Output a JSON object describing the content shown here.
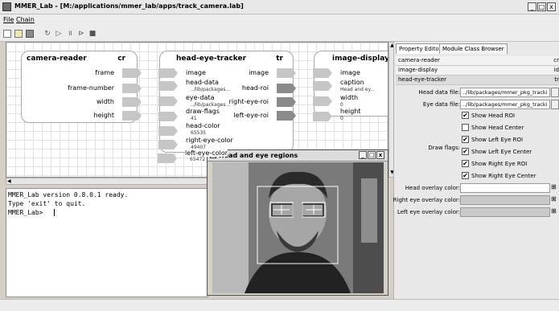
{
  "window": {
    "title": "MMER_Lab - [M:/applications/mmer_lab/apps/track_camera.lab]",
    "min": "_",
    "max": "□",
    "close": "x"
  },
  "menu": {
    "file": "File",
    "chain": "Chain"
  },
  "toolbar": {
    "icons": [
      "new-icon",
      "open-icon",
      "save-icon",
      "refresh-icon",
      "play-icon",
      "pause-icon",
      "step-icon",
      "stop-icon"
    ]
  },
  "nodes": {
    "camera_reader": {
      "title": "camera-reader",
      "abbr": "cr",
      "ports": [
        "frame",
        "frame-number",
        "width",
        "height"
      ]
    },
    "head_eye_tracker": {
      "title": "head-eye-tracker",
      "abbr": "tr",
      "inputs": [
        {
          "label": "image",
          "value": ""
        },
        {
          "label": "head-data",
          "value": "../lib/packages..."
        },
        {
          "label": "eye-data",
          "value": "../lib/packages..."
        },
        {
          "label": "draw-flags",
          "value": "41"
        },
        {
          "label": "head-color",
          "value": "65535"
        },
        {
          "label": "right-eye-color",
          "value": "49407"
        },
        {
          "label": "left-eye-color",
          "value": "65472"
        }
      ],
      "outputs": [
        "image",
        "head-roi",
        "right-eye-roi",
        "left-eye-roi"
      ]
    },
    "image_display": {
      "title": "image-display",
      "inputs": [
        {
          "label": "image",
          "value": ""
        },
        {
          "label": "caption",
          "value": "Head and ey..."
        },
        {
          "label": "width",
          "value": "0"
        },
        {
          "label": "height",
          "value": "0"
        }
      ]
    }
  },
  "console": {
    "lines": [
      "MMER_Lab version 0.8.0.1 ready.",
      "Type 'exit' to quit.",
      "MMER_Lab> "
    ]
  },
  "image_window": {
    "title": "Head and eye regions"
  },
  "property_panel": {
    "tabs": [
      "Property Editor",
      "Module Class Browser"
    ],
    "modules": [
      {
        "name": "camera-reader",
        "abbr": "cr"
      },
      {
        "name": "image-display",
        "abbr": "id"
      },
      {
        "name": "head-eye-tracker",
        "abbr": "tr"
      }
    ],
    "head_data_label": "Head data file:",
    "head_data_value": "../lib/packages/mmer_pkg_tracki",
    "eye_data_label": "Eye data file:",
    "eye_data_value": "../lib/packages/mmer_pkg_tracki",
    "draw_flags_label": "Draw flags:",
    "flags": [
      {
        "label": "Show Head ROI",
        "checked": true
      },
      {
        "label": "Show Head Center",
        "checked": false
      },
      {
        "label": "Show Left Eye ROI",
        "checked": true
      },
      {
        "label": "Show Left Eye Center",
        "checked": true
      },
      {
        "label": "Show Right Eye ROI",
        "checked": true
      },
      {
        "label": "Show Right Eye Center",
        "checked": true
      }
    ],
    "head_overlay_label": "Head overlay color:",
    "right_eye_overlay_label": "Right eye overlay color:",
    "left_eye_overlay_label": "Left eye overlay color:",
    "colors": {
      "head": "#ffffff",
      "right_eye": "#c9c9c9",
      "left_eye": "#c9c9c9"
    }
  },
  "check_mark": "✔"
}
